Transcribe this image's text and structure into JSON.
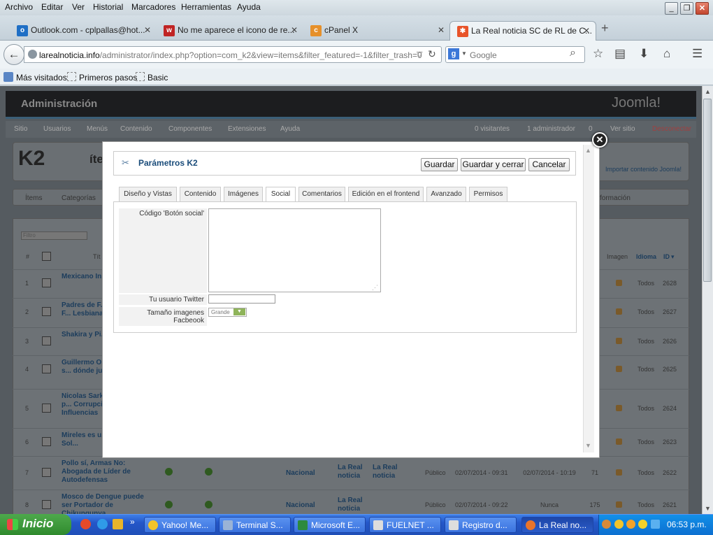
{
  "menu": [
    "Archivo",
    "Editar",
    "Ver",
    "Historial",
    "Marcadores",
    "Herramientas",
    "Ayuda"
  ],
  "tabs": [
    {
      "label": "Outlook.com - cplpallas@hot..."
    },
    {
      "label": "No me aparece el icono de re..."
    },
    {
      "label": "cPanel X"
    },
    {
      "label": "La Real noticia SC de RL de C..."
    }
  ],
  "url": {
    "domain": "larealnoticia.info",
    "path": "/administrator/index.php?option=com_k2&view=items&filter_featured=-1&filter_trash=0"
  },
  "search_placeholder": "Google",
  "bookmarks": [
    "Más visitados",
    "Primeros pasos",
    "Basic"
  ],
  "admin": {
    "title": "Administración",
    "logo": "Joomla!",
    "menu": [
      "Sitio",
      "Usuarios",
      "Menús",
      "Contenido",
      "Componentes",
      "Extensiones",
      "Ayuda"
    ],
    "status": [
      "0 visitantes",
      "1 administrador",
      "0",
      "Ver sitio",
      "Desconectar"
    ],
    "k2_label": "K2",
    "import_label": "Importar contenido Joomla!",
    "subtabs": [
      "Ítems",
      "Categorías"
    ],
    "filter_placeholder": "Filtro",
    "col_image": "Imagen",
    "col_lang": "Idioma",
    "col_id": "ID",
    "col_hash": "#",
    "col_title_fragment": "Tít",
    "info_fragment": "formación",
    "k2_header_fragment": "íte"
  },
  "rows": [
    {
      "n": "1",
      "title": "Mexicano In... Persie",
      "lang": "Todos",
      "id": "2628"
    },
    {
      "n": "2",
      "title": "Padres de F... Golpean a F... Lesbiana",
      "lang": "Todos",
      "id": "2627"
    },
    {
      "n": "3",
      "title": "Shakira y Pi... vacacionan",
      "lang": "Todos",
      "id": "2626"
    },
    {
      "n": "4",
      "title": "Guillermo O... todavía no s... dónde jugar",
      "lang": "Todos",
      "id": "2625"
    },
    {
      "n": "5",
      "title": "Nicolas Sark... Imputado p... Corrupción y... Influencias",
      "lang": "Todos",
      "id": "2624"
    },
    {
      "n": "6",
      "title": "Mireles es u... político: Sol...",
      "lang": "Todos",
      "id": "2623"
    },
    {
      "n": "7",
      "title": "Pollo sí, Armas No: Abogada de Líder de Autodefensas",
      "cat": "Nacional",
      "group": "La Real noticia",
      "group2": "La Real noticia",
      "pub": "Público",
      "date": "02/07/2014 - 09:31",
      "mod": "02/07/2014 - 10:19",
      "hits": "71",
      "lang": "Todos",
      "id": "2622"
    },
    {
      "n": "8",
      "title": "Mosco de Dengue puede ser Portador de Chikungunya",
      "cat": "Nacional",
      "group": "La Real noticia",
      "pub": "Público",
      "date": "02/07/2014 - 09:22",
      "mod": "Nunca",
      "hits": "175",
      "lang": "Todos",
      "id": "2621"
    }
  ],
  "modal": {
    "title": "Parámetros K2",
    "buttons": {
      "save": "Guardar",
      "save_close": "Guardar y cerrar",
      "cancel": "Cancelar"
    },
    "tabs": [
      "Diseño y Vistas",
      "Contenido",
      "Imágenes",
      "Social",
      "Comentarios",
      "Edición en el frontend",
      "Avanzado",
      "Permisos"
    ],
    "active_tab": "Social",
    "fields": {
      "social_code_label": "Código 'Botón social'",
      "twitter_label": "Tu usuario Twitter",
      "fb_size_label": "Tamaño imagenes Facbeook",
      "fb_size_value": "Grande"
    }
  },
  "taskbar": {
    "start": "Inicio",
    "items": [
      "Yahoo! Me...",
      "Terminal S...",
      "Microsoft E...",
      "FUELNET ...",
      "Registro d...",
      "La Real no..."
    ],
    "clock": "06:53 p.m."
  }
}
